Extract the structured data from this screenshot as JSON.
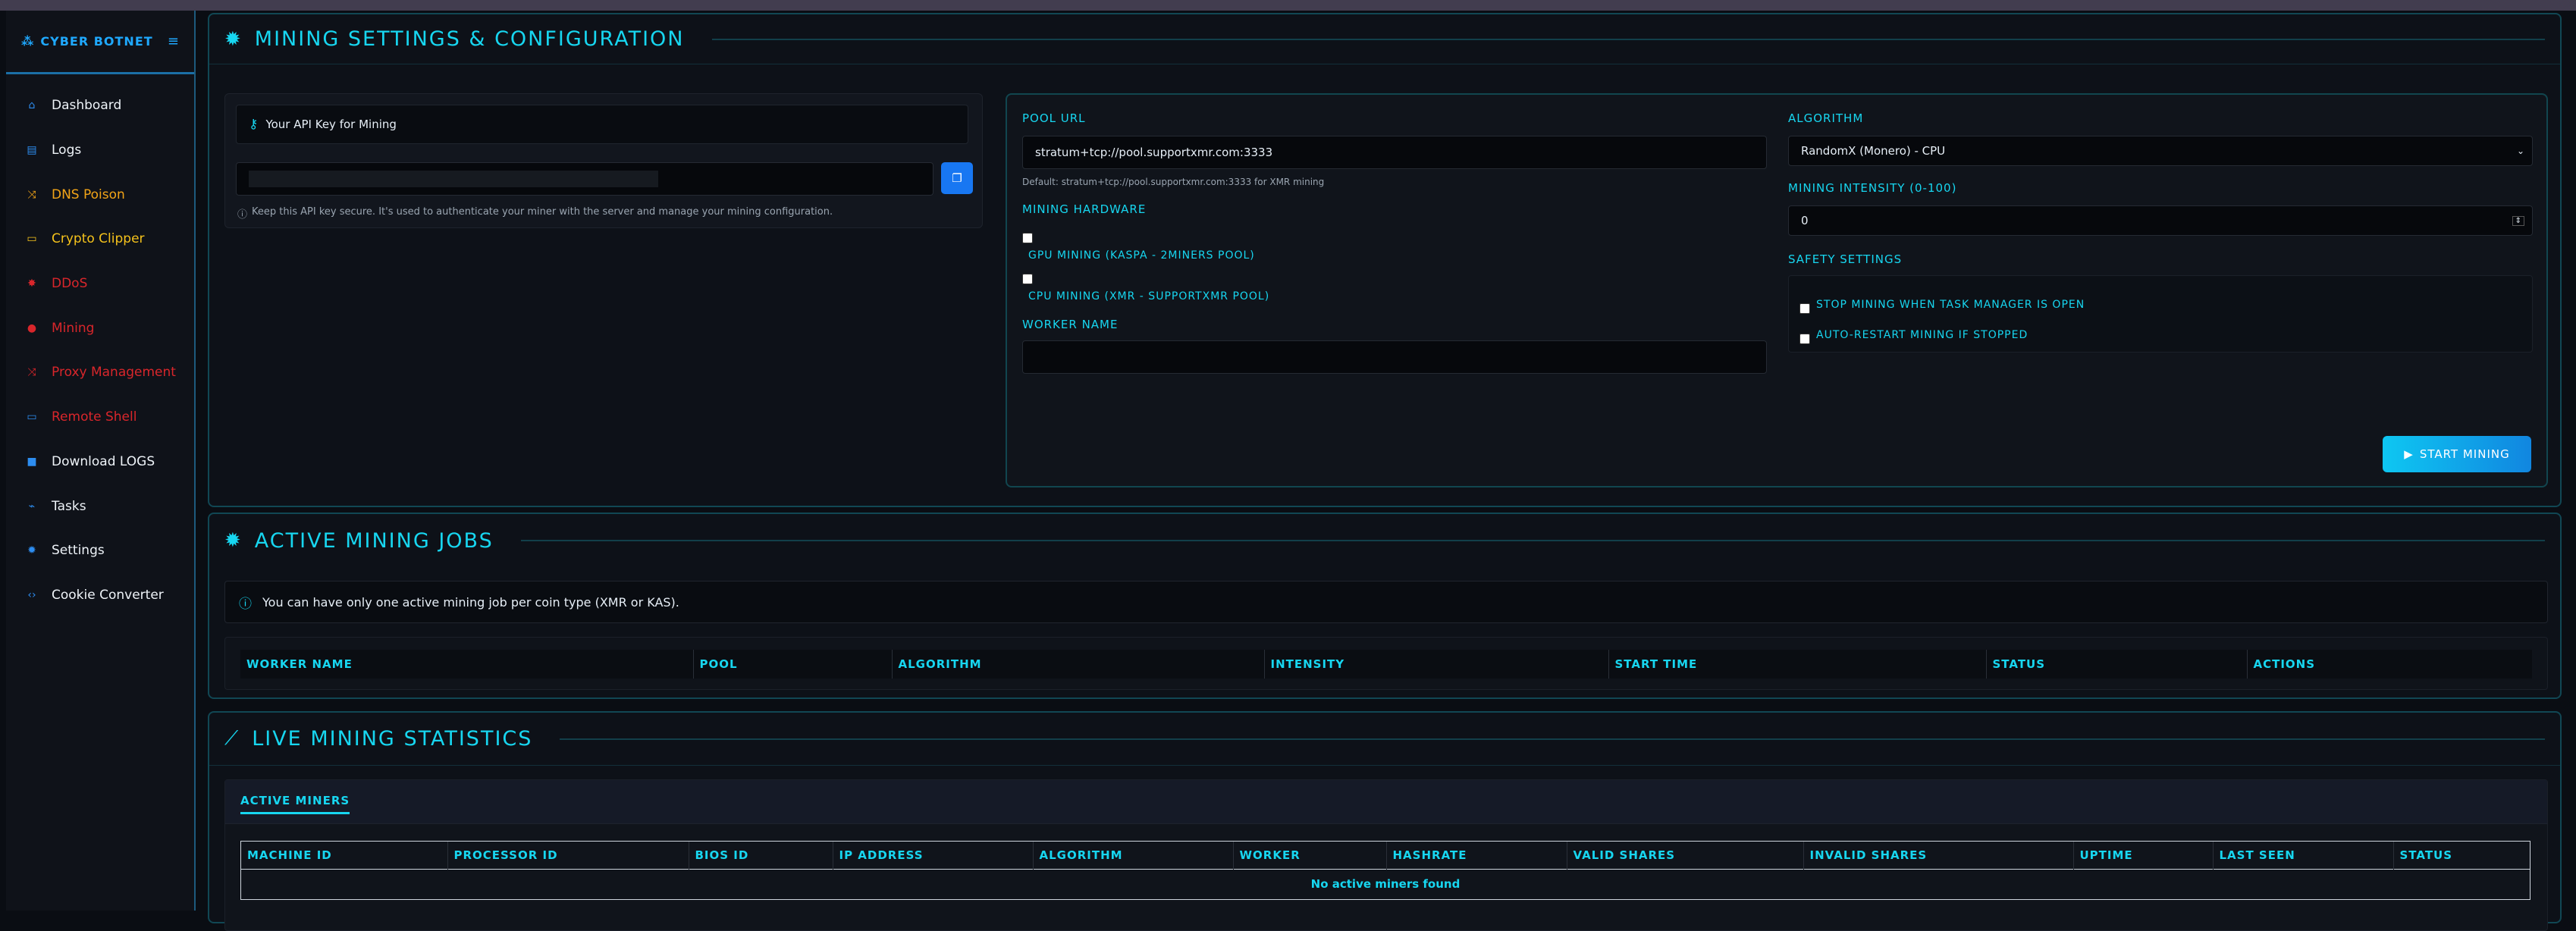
{
  "brand": {
    "name": "CYBER BOTNET",
    "icon": "network-icon",
    "toggle_icon": "hamburger-icon"
  },
  "sidebar": {
    "items": [
      {
        "label": "Dashboard",
        "icon": "home-icon",
        "color": "white"
      },
      {
        "label": "Logs",
        "icon": "file-icon",
        "color": "white"
      },
      {
        "label": "DNS Poison",
        "icon": "shuffle-icon",
        "color": "orange"
      },
      {
        "label": "Crypto Clipper",
        "icon": "card-icon",
        "color": "yellow"
      },
      {
        "label": "DDoS",
        "icon": "burst-icon",
        "color": "red"
      },
      {
        "label": "Mining",
        "icon": "circle-icon",
        "color": "red"
      },
      {
        "label": "Proxy Management",
        "icon": "shuffle-icon",
        "color": "red"
      },
      {
        "label": "Remote Shell",
        "icon": "monitor-icon",
        "color": "red"
      },
      {
        "label": "Download LOGS",
        "icon": "square-icon",
        "color": "white"
      },
      {
        "label": "Tasks",
        "icon": "chart-icon",
        "color": "white"
      },
      {
        "label": "Settings",
        "icon": "gear-icon",
        "color": "white"
      },
      {
        "label": "Cookie Converter",
        "icon": "code-icon",
        "color": "white"
      }
    ]
  },
  "settings": {
    "title": "MINING SETTINGS & CONFIGURATION",
    "api_key_label": "Your API Key for Mining",
    "api_key_value": "",
    "api_key_note": "Keep this API key secure. It's used to authenticate your miner with the server and manage your mining configuration.",
    "pool_url_label": "POOL URL",
    "pool_url_value": "stratum+tcp://pool.supportxmr.com:3333",
    "pool_url_note": "Default: stratum+tcp://pool.supportxmr.com:3333 for XMR mining",
    "hardware_label": "MINING HARDWARE",
    "gpu_option": "GPU MINING (KASPA - 2MINERS POOL)",
    "cpu_option": "CPU MINING (XMR - SUPPORTXMR POOL)",
    "worker_label": "WORKER NAME",
    "worker_value": "",
    "algorithm_label": "ALGORITHM",
    "algorithm_value": "RandomX (Monero) - CPU",
    "intensity_label": "MINING INTENSITY (0-100)",
    "intensity_value": "0",
    "safety_label": "SAFETY SETTINGS",
    "safety_option1": "STOP MINING WHEN TASK MANAGER IS OPEN",
    "safety_option2": "AUTO-RESTART MINING IF STOPPED",
    "start_button": "START MINING"
  },
  "jobs": {
    "title": "ACTIVE MINING JOBS",
    "info": "You can have only one active mining job per coin type (XMR or KAS).",
    "columns": [
      "WORKER NAME",
      "POOL",
      "ALGORITHM",
      "INTENSITY",
      "START TIME",
      "STATUS",
      "ACTIONS"
    ]
  },
  "stats": {
    "title": "LIVE MINING STATISTICS",
    "tab": "ACTIVE MINERS",
    "columns": [
      "MACHINE ID",
      "PROCESSOR ID",
      "BIOS ID",
      "IP ADDRESS",
      "ALGORITHM",
      "WORKER",
      "HASHRATE",
      "VALID SHARES",
      "INVALID SHARES",
      "UPTIME",
      "LAST SEEN",
      "STATUS"
    ],
    "empty": "No active miners found"
  },
  "colors": {
    "accent": "#17d6f0",
    "brand": "#1fa9ff",
    "button": "#11a6e8"
  }
}
